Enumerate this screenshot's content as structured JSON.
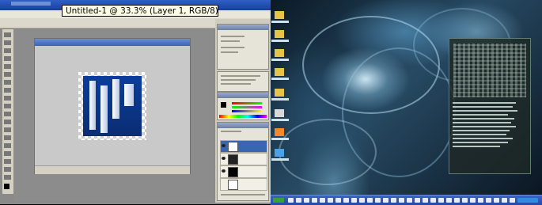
{
  "tooltip": {
    "document_title": "Untitled-1 @ 33.3% (Layer 1, RGB/8)"
  },
  "colors": {
    "tooltip_background": "#fdfde5",
    "window_titlebar": "#1a3f9a",
    "logo_blue": "#0b3d9c",
    "taskbar": "#2449a8",
    "workspace_gray": "#8c8c8c"
  },
  "icons": [
    "eye-icon",
    "layer-thumbnail",
    "tool-icon",
    "desktop-icon",
    "taskbar-icon"
  ]
}
